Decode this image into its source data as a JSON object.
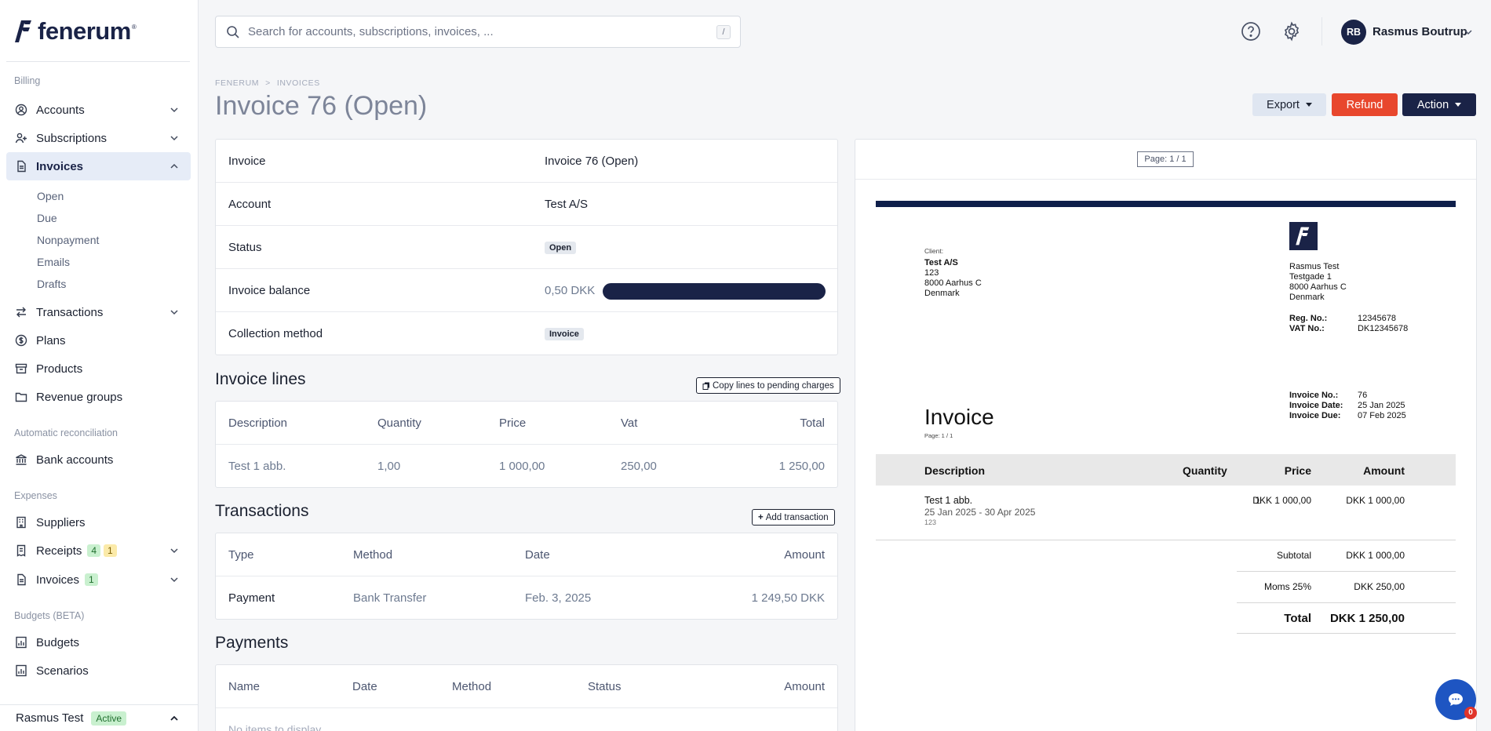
{
  "brand": {
    "name": "fenerum",
    "reg": "®"
  },
  "sidebar": {
    "section_billing": "Billing",
    "accounts": "Accounts",
    "subscriptions": "Subscriptions",
    "invoices": "Invoices",
    "invoice_sub": [
      "Open",
      "Due",
      "Nonpayment",
      "Emails",
      "Drafts"
    ],
    "transactions": "Transactions",
    "plans": "Plans",
    "products": "Products",
    "revenue_groups": "Revenue groups",
    "section_reconciliation": "Automatic reconciliation",
    "bank_accounts": "Bank accounts",
    "section_expenses": "Expenses",
    "suppliers": "Suppliers",
    "receipts": "Receipts",
    "receipts_badge_green": "4",
    "receipts_badge_yellow": "1",
    "exp_invoices": "Invoices",
    "exp_invoices_badge": "1",
    "section_budgets": "Budgets (BETA)",
    "budgets": "Budgets",
    "scenarios": "Scenarios",
    "org_name": "Rasmus Test",
    "org_status": "Active"
  },
  "topbar": {
    "search_placeholder": "Search for accounts, subscriptions, invoices, ...",
    "search_shortcut": "/",
    "user_initials": "RB",
    "user_name": "Rasmus Boutrup"
  },
  "header": {
    "breadcrumb": [
      "FENERUM",
      "INVOICES"
    ],
    "breadcrumb_sep": ">",
    "title": "Invoice 76 (Open)",
    "export_label": "Export",
    "refund_label": "Refund",
    "action_label": "Action"
  },
  "info": {
    "invoice_label": "Invoice",
    "invoice_value": "Invoice 76 (Open)",
    "account_label": "Account",
    "account_value": "Test A/S",
    "status_label": "Status",
    "status_value": "Open",
    "balance_label": "Invoice balance",
    "balance_value": "0,50 DKK",
    "balance_fraction_paid": 1.0,
    "collection_label": "Collection method",
    "collection_value": "Invoice"
  },
  "invoice_lines": {
    "title": "Invoice lines",
    "copy_button": "Copy lines to pending charges",
    "columns": [
      "Description",
      "Quantity",
      "Price",
      "Vat",
      "Total"
    ],
    "rows": [
      [
        "Test 1 abb.",
        "1,00",
        "1 000,00",
        "250,00",
        "1 250,00"
      ]
    ]
  },
  "transactions": {
    "title": "Transactions",
    "add_button": "Add transaction",
    "columns": [
      "Type",
      "Method",
      "Date",
      "Amount"
    ],
    "rows": [
      [
        "Payment",
        "Bank Transfer",
        "Feb. 3, 2025",
        "1 249,50 DKK"
      ]
    ]
  },
  "payments": {
    "title": "Payments",
    "columns": [
      "Name",
      "Date",
      "Method",
      "Status",
      "Amount"
    ],
    "empty": "No items to display"
  },
  "preview": {
    "page_indicator": "Page: 1 / 1",
    "client_label": "Client:",
    "client_lines": [
      "Test A/S",
      "123",
      "8000 Aarhus C",
      "Denmark"
    ],
    "sender_lines": [
      "Rasmus Test",
      "Testgade 1",
      "8000 Aarhus C",
      "Denmark"
    ],
    "reg_label": "Reg. No.:",
    "reg_value": "12345678",
    "vat_label": "VAT No.:",
    "vat_value": "DK12345678",
    "inv_no_label": "Invoice No.:",
    "inv_no_value": "76",
    "inv_date_label": "Invoice Date:",
    "inv_date_value": "25 Jan 2025",
    "inv_due_label": "Invoice Due:",
    "inv_due_value": "07 Feb 2025",
    "doc_title": "Invoice",
    "doc_page": "Page: 1 / 1",
    "columns": [
      "Description",
      "Quantity",
      "Price",
      "Amount"
    ],
    "line_desc": "Test 1 abb.",
    "line_period": "25 Jan 2025 - 30 Apr 2025",
    "line_extra": "123",
    "line_qty": "1",
    "line_price": "DKK 1 000,00",
    "line_amount": "DKK 1 000,00",
    "subtotal_label": "Subtotal",
    "subtotal_value": "DKK 1 000,00",
    "vat_line_label": "Moms 25%",
    "vat_line_value": "DKK 250,00",
    "total_label": "Total",
    "total_value": "DKK 1 250,00"
  },
  "chat": {
    "count": "0"
  }
}
